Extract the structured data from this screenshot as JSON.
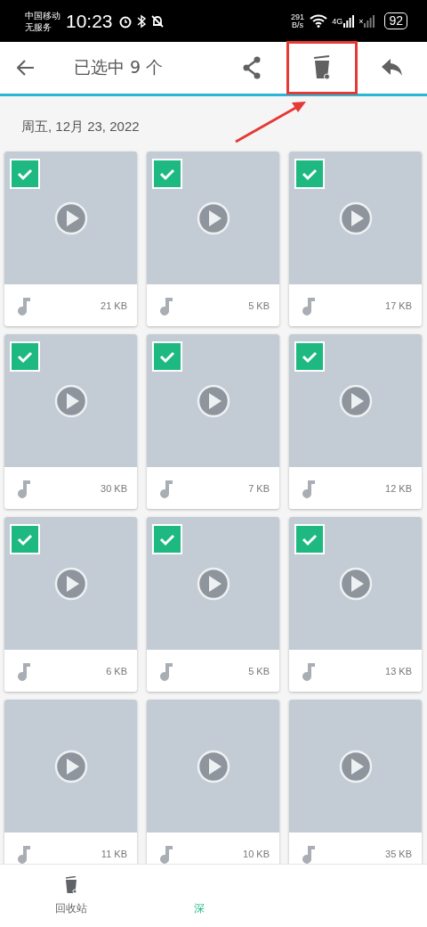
{
  "status_bar": {
    "carrier": "中国移动",
    "service": "无服务",
    "time": "10:23",
    "speed": "291",
    "speed_unit": "B/s",
    "network": "4G",
    "sim2": "×",
    "battery": "92"
  },
  "toolbar": {
    "title": "已选中 9 个",
    "actions": [
      {
        "kind": "share",
        "highlighted": false
      },
      {
        "kind": "delete",
        "highlighted": true
      },
      {
        "kind": "reply",
        "highlighted": false
      }
    ]
  },
  "date_header": "周五, 12月 23, 2022",
  "items": [
    {
      "size": "21 KB",
      "checked": true
    },
    {
      "size": "5 KB",
      "checked": true
    },
    {
      "size": "17 KB",
      "checked": true
    },
    {
      "size": "30 KB",
      "checked": true
    },
    {
      "size": "7 KB",
      "checked": true
    },
    {
      "size": "12 KB",
      "checked": true
    },
    {
      "size": "6 KB",
      "checked": true
    },
    {
      "size": "5 KB",
      "checked": true
    },
    {
      "size": "13 KB",
      "checked": true
    },
    {
      "size": "11 KB",
      "checked": false
    },
    {
      "size": "10 KB",
      "checked": false
    },
    {
      "size": "35 KB",
      "checked": false
    }
  ],
  "bottom_tabs": [
    {
      "label": "回收站",
      "selected": false,
      "kind": "trash"
    },
    {
      "label": "深",
      "selected": true,
      "kind": "hidden"
    }
  ]
}
